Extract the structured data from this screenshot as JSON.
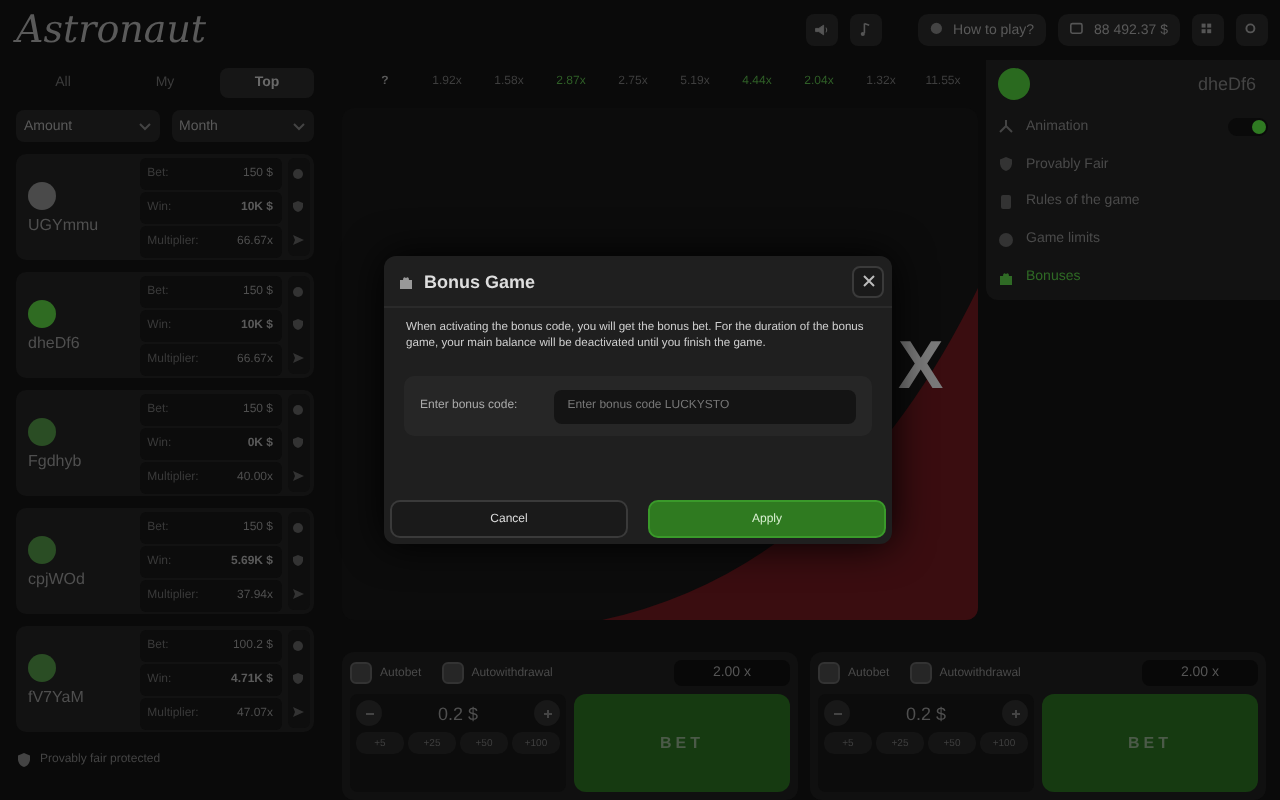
{
  "header": {
    "logo": "Astronaut",
    "help": "How to play?",
    "balance": "88 492.37 $"
  },
  "board": {
    "tabs": [
      {
        "label": "All",
        "selected": false
      },
      {
        "label": "My",
        "selected": false
      },
      {
        "label": "Top",
        "selected": true
      }
    ],
    "filters": [
      "Amount",
      "Month"
    ],
    "entries": [
      {
        "name": "UGYmmu",
        "color": "#4a4a4a",
        "bet_label": "Bet:",
        "bet": "150 $",
        "win_label": "Win:",
        "win": "10K $",
        "multiplier_label": "Multiplier:",
        "multiplier": "66.67x"
      },
      {
        "name": "dheDf6",
        "color": "#2f6b22",
        "bet_label": "Bet:",
        "bet": "150 $",
        "win_label": "Win:",
        "win": "10K $",
        "multiplier_label": "Multiplier:",
        "multiplier": "66.67x"
      },
      {
        "name": "Fgdhyb",
        "color": "#2a4d24",
        "bet_label": "Bet:",
        "bet": "150 $",
        "win_label": "Win:",
        "win": "0K $",
        "multiplier_label": "Multiplier:",
        "multiplier": "40.00x"
      },
      {
        "name": "cpjWOd",
        "color": "#2a4d24",
        "bet_label": "Bet:",
        "bet": "150 $",
        "win_label": "Win:",
        "win": "5.69K $",
        "multiplier_label": "Multiplier:",
        "multiplier": "37.94x"
      },
      {
        "name": "fV7YaM",
        "color": "#2a4d24",
        "bet_label": "Bet:",
        "bet": "100.2 $",
        "win_label": "Win:",
        "win": "4.71K $",
        "multiplier_label": "Multiplier:",
        "multiplier": "47.07x"
      }
    ],
    "footer": "Provably fair protected"
  },
  "history": [
    {
      "value": "?",
      "kind": "pending"
    },
    {
      "value": "1.92x",
      "kind": "low"
    },
    {
      "value": "1.58x",
      "kind": "low"
    },
    {
      "value": "2.87x",
      "kind": "high"
    },
    {
      "value": "2.75x",
      "kind": "low"
    },
    {
      "value": "5.19x",
      "kind": "low"
    },
    {
      "value": "4.44x",
      "kind": "high"
    },
    {
      "value": "2.04x",
      "kind": "high"
    },
    {
      "value": "1.32x",
      "kind": "low"
    },
    {
      "value": "11.55x",
      "kind": "low"
    }
  ],
  "game": {
    "multiplier": "X"
  },
  "menu": {
    "user": "dheDf6",
    "items": [
      {
        "kind": "toggle",
        "label": "Animation",
        "on": true
      },
      {
        "kind": "link",
        "label": "Provably Fair",
        "selected": false
      },
      {
        "kind": "link",
        "label": "Rules of the game",
        "selected": false
      },
      {
        "kind": "link",
        "label": "Game limits",
        "selected": false
      },
      {
        "kind": "link",
        "label": "Bonuses",
        "selected": true
      }
    ]
  },
  "modal": {
    "title": "Bonus Game",
    "text": "When activating the bonus code, you will get the bonus bet. For the duration of the bonus game, your main balance will be deactivated until you finish the game.",
    "field_label": "Enter bonus code:",
    "placeholder": "Enter bonus code LUCKYSTO",
    "cancel": "Cancel",
    "apply": "Apply"
  },
  "bets": [
    {
      "autobet_label": "Autobet",
      "autobet": false,
      "autowithdrawal_label": "Autowithdrawal",
      "autowithdrawal": false,
      "cashout": "2.00 x",
      "amount": "0.2 $",
      "quick": [
        "+5",
        "+25",
        "+50",
        "+100"
      ],
      "button": "BET"
    },
    {
      "autobet_label": "Autobet",
      "autobet": false,
      "autowithdrawal_label": "Autowithdrawal",
      "autowithdrawal": false,
      "cashout": "2.00 x",
      "amount": "0.2 $",
      "quick": [
        "+5",
        "+25",
        "+50",
        "+100"
      ],
      "button": "BET"
    }
  ]
}
